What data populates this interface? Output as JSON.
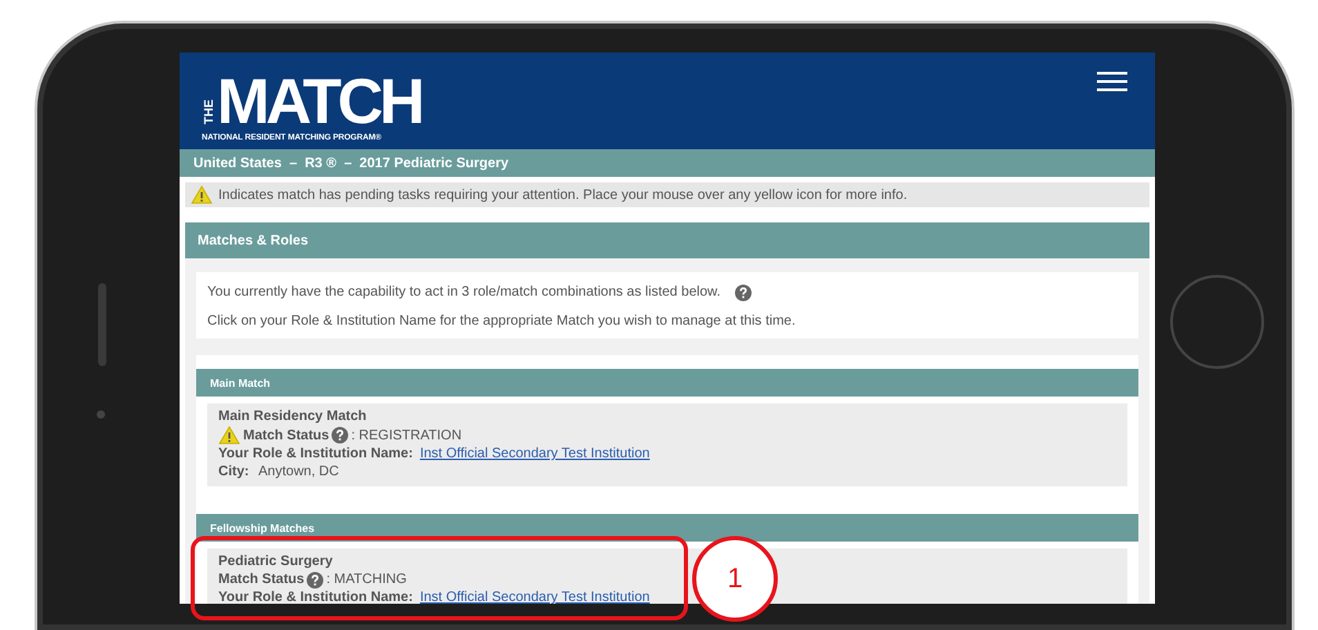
{
  "header": {
    "logo_mark": "THE",
    "logo_title": "MATCH",
    "logo_subtitle": "NATIONAL RESIDENT MATCHING PROGRAM®"
  },
  "breadcrumb": "United States  –  R3 ®  –  2017 Pediatric Surgery",
  "notice": "Indicates match has pending tasks requiring your attention. Place your mouse over any yellow icon for more info.",
  "panel": {
    "title": "Matches & Roles",
    "intro": [
      "You currently have the capability to act in 3 role/match combinations as listed below.",
      "Click on your Role & Institution Name for the appropriate Match you wish to manage at this time."
    ],
    "groups": [
      {
        "title": "Main Match",
        "entries": [
          {
            "name": "Main Residency Match",
            "pending": true,
            "status_label": "Match Status",
            "status": ": REGISTRATION",
            "role_label": "Your Role & Institution Name:",
            "role_link": "Inst Official Secondary Test Institution",
            "city_label": "City:",
            "city": "Anytown, DC"
          }
        ]
      },
      {
        "title": "Fellowship Matches",
        "entries": [
          {
            "name": "Pediatric Surgery",
            "pending": false,
            "status_label": "Match Status",
            "status": ": MATCHING",
            "role_label": "Your Role & Institution Name:",
            "role_link": "Inst Official Secondary Test Institution"
          }
        ]
      }
    ]
  },
  "annotation": {
    "number": "1"
  }
}
